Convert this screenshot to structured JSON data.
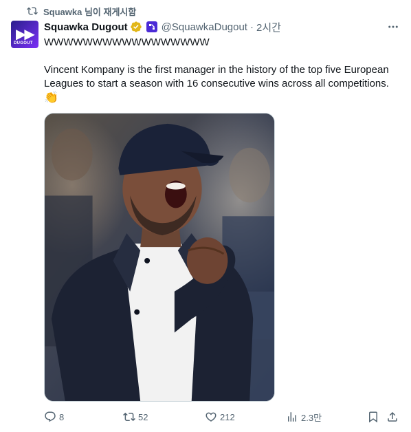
{
  "repost": {
    "text": "Squawka 님이 재게시함",
    "icon": "repost-icon"
  },
  "author": {
    "avatar_text": "DUGOUT",
    "name": "Squawka Dugout",
    "handle": "@SquawkaDugout",
    "separator": "·",
    "time": "2시간",
    "verified_color": "#e2b719",
    "affiliate_color": "#4b2bd6"
  },
  "tweet": {
    "line1": "WWWWWWWWWWWWWWWWW",
    "body": "Vincent Kompany is the first manager in the history of the top five European Leagues to start a season with 16 consecutive wins across all competitions.",
    "emoji": "👏"
  },
  "media": {
    "alt": "Vincent Kompany celebrating with a fist pump"
  },
  "actions": {
    "replies": "8",
    "reposts": "52",
    "likes": "212",
    "views": "2.3만"
  },
  "colors": {
    "text": "#0f1419",
    "secondary": "#536471",
    "border": "#cfd9de"
  }
}
